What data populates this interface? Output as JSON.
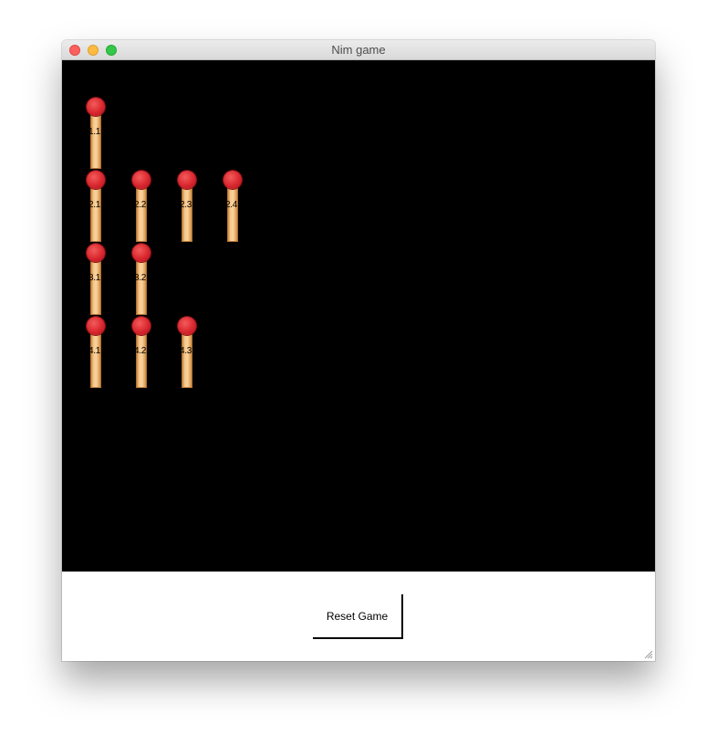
{
  "window": {
    "title": "Nim game"
  },
  "board": {
    "background": "#000000",
    "rows": [
      {
        "row": 1,
        "matches": [
          {
            "label": "1.1"
          }
        ]
      },
      {
        "row": 2,
        "matches": [
          {
            "label": "2.1"
          },
          {
            "label": "2.2"
          },
          {
            "label": "2.3"
          },
          {
            "label": "2.4"
          }
        ]
      },
      {
        "row": 3,
        "matches": [
          {
            "label": "3.1"
          },
          {
            "label": "3.2"
          }
        ]
      },
      {
        "row": 4,
        "matches": [
          {
            "label": "4.1"
          },
          {
            "label": "4.2"
          },
          {
            "label": "4.3"
          }
        ]
      }
    ],
    "match_colors": {
      "head": "#d8262e",
      "stick": "#f6c88c"
    }
  },
  "footer": {
    "reset_label": "Reset Game"
  },
  "icons": {
    "close": "close-icon",
    "minimize": "minimize-icon",
    "maximize": "maximize-icon",
    "resize": "resize-grip-icon"
  }
}
